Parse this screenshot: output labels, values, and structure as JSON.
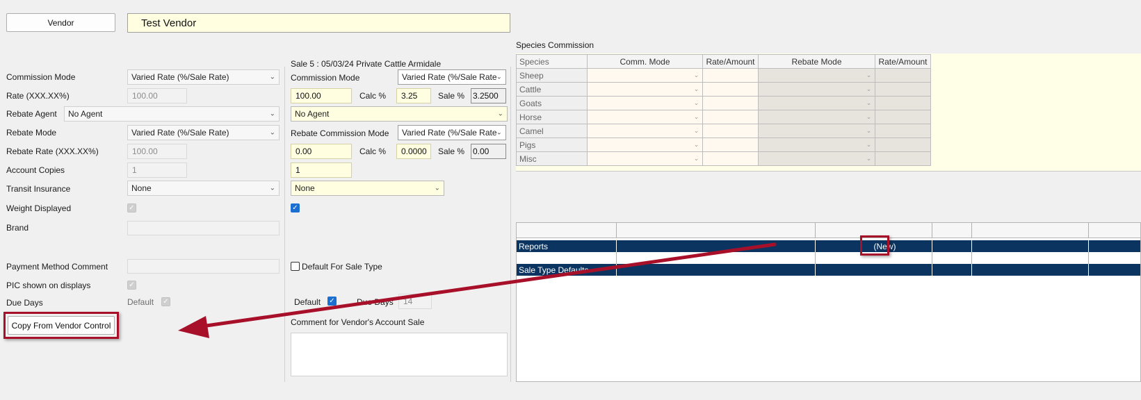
{
  "vendor_button": "Vendor",
  "vendor_name": "Test Vendor",
  "left": {
    "commission_mode_label": "Commission Mode",
    "commission_mode_value": "Varied Rate (%/Sale Rate)",
    "rate_label": "Rate (XXX.XX%)",
    "rate_value": "100.00",
    "rebate_agent_label": "Rebate Agent",
    "rebate_agent_value": "No Agent",
    "rebate_mode_label": "Rebate Mode",
    "rebate_mode_value": "Varied Rate (%/Sale Rate)",
    "rebate_rate_label": "Rebate Rate (XXX.XX%)",
    "rebate_rate_value": "100.00",
    "account_copies_label": "Account Copies",
    "account_copies_value": "1",
    "transit_insurance_label": "Transit Insurance",
    "transit_insurance_value": "None",
    "weight_displayed_label": "Weight Displayed",
    "brand_label": "Brand",
    "payment_method_comment_label": "Payment Method Comment",
    "pic_shown_label": "PIC shown on displays",
    "due_days_label": "Due Days",
    "due_days_default_label": "Default",
    "copy_button": "Copy From Vendor Control"
  },
  "sale": {
    "group_title": "Sale 5 : 05/03/24 Private Cattle Armidale",
    "commission_mode_label": "Commission Mode",
    "commission_mode_value": "Varied Rate (%/Sale Rate",
    "rate_value": "100.00",
    "calc_label": "Calc %",
    "calc_value": "3.25",
    "sale_pct_label": "Sale %",
    "sale_pct_value": "3.2500",
    "agent_value": "No Agent",
    "rebate_commission_mode_label": "Rebate Commission Mode",
    "rebate_commission_mode_value": "Varied Rate (%/Sale Rate",
    "rebate_rate_value": "0.00",
    "rebate_calc_label": "Calc %",
    "rebate_calc_value": "0.0000",
    "rebate_sale_pct_label": "Sale %",
    "rebate_sale_pct_value": "0.00",
    "copies_value": "1",
    "transit_value": "None",
    "default_for_sale_type_label": "Default For Sale Type",
    "default_label": "Default",
    "due_days_label": "Due Days",
    "due_days_value": "14",
    "comment_label": "Comment for Vendor's Account Sale"
  },
  "species": {
    "title": "Species Commission",
    "headers": [
      "Species",
      "Comm. Mode",
      "Rate/Amount",
      "Rebate Mode",
      "Rate/Amount"
    ],
    "rows": [
      "Sheep",
      "Cattle",
      "Goats",
      "Horse",
      "Camel",
      "Pigs",
      "Misc"
    ]
  },
  "lower_grid": {
    "reports_label": "Reports",
    "new_label": "(New)",
    "sale_type_defaults_label": "Sale Type Defaults"
  },
  "colors": {
    "selected_row": "#0b3560",
    "annotation_red": "#a8102a",
    "yellow_field": "#fffee0"
  }
}
